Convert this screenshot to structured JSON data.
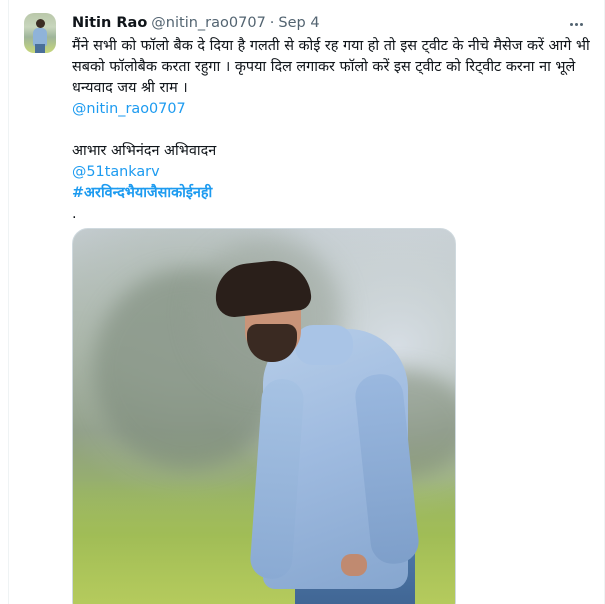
{
  "tweet": {
    "author_name": "Nitin Rao",
    "author_handle": "@nitin_rao0707",
    "separator": "·",
    "date": "Sep 4",
    "text_lines": [
      "मैंने सभी को फॉलो बैक दे दिया है गलती से कोई रह गया हो तो इस ट्वीट के नीचे मैसेज करें आगे भी",
      "सबको  फॉलोबैक करता रहुगा । कृपया दिल लगाकर फॉलो करें इस ट्वीट को रिट्वीट करना ना भूले",
      "धन्यवाद जय श्री राम ।"
    ],
    "mention_1": "@nitin_rao0707",
    "thanks_line": "आभार अभिनंदन अभिवादन",
    "mention_2": "@51tankarv",
    "hashtag": "#अरविन्दभैयाजैसाकोईनही",
    "trailing": "."
  },
  "colors": {
    "link": "#1d9bf0",
    "secondary_text": "#536471",
    "primary_text": "#0f1419"
  },
  "icons": {
    "more": "more-horizontal-icon"
  }
}
